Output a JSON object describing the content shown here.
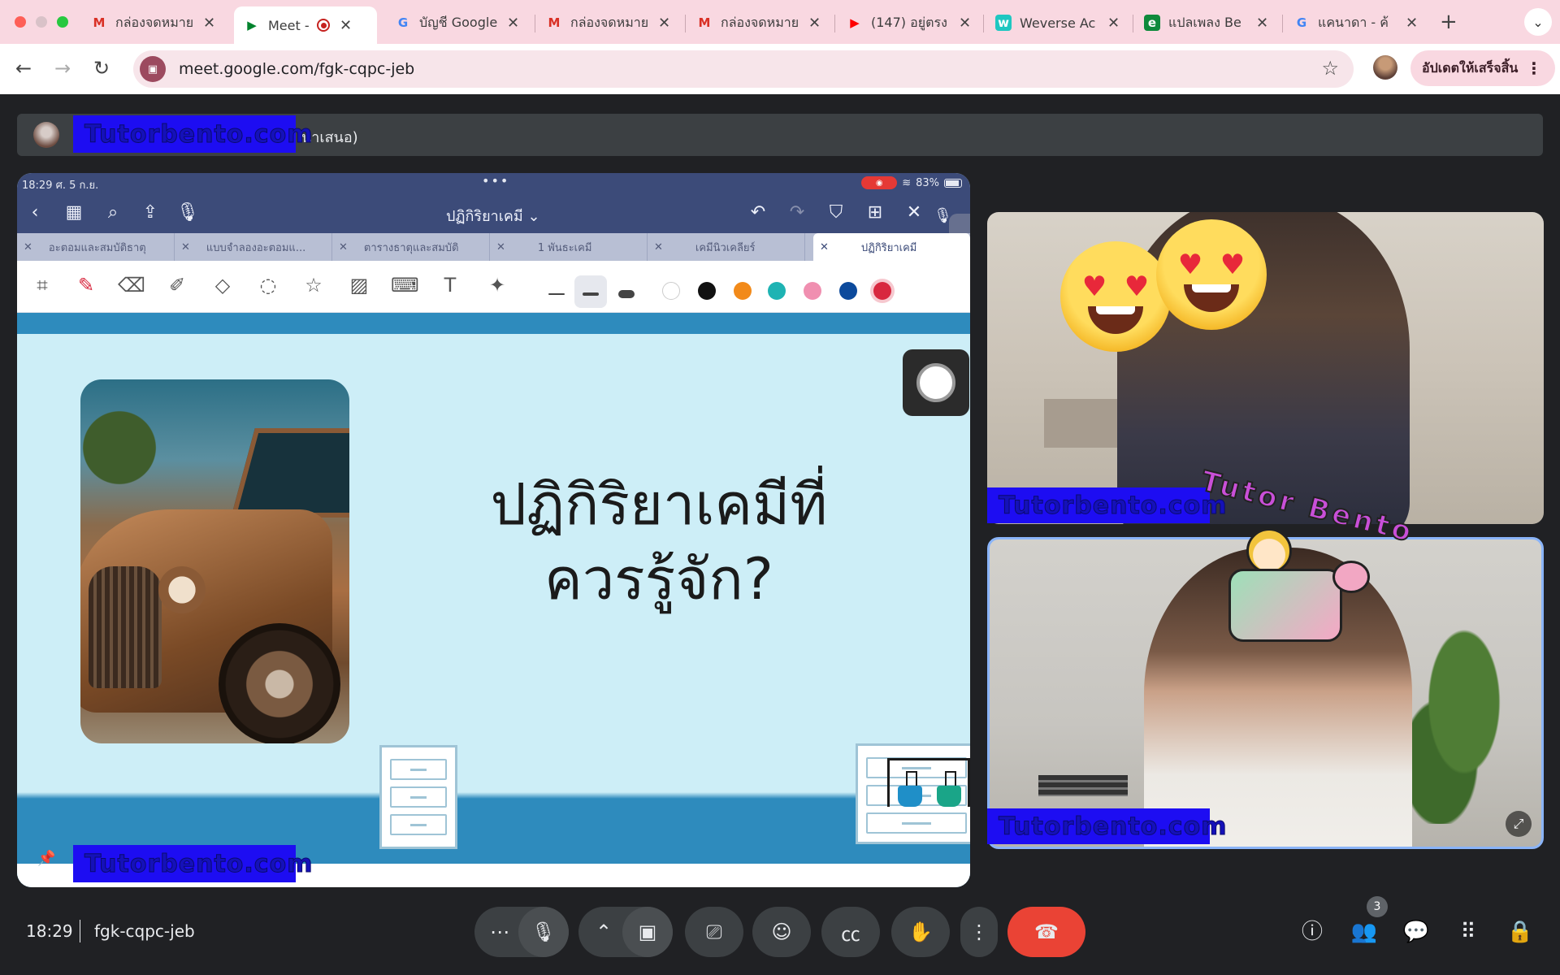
{
  "browser": {
    "tabs": [
      {
        "title": "กล่องจดหมาย",
        "icon": "gmail-icon"
      },
      {
        "title": "Meet - fgk-cqpc-jeb",
        "icon": "meet-icon",
        "active": true,
        "recording": true
      },
      {
        "title": "บัญชี Google",
        "icon": "google-icon"
      },
      {
        "title": "กล่องจดหมาย",
        "icon": "gmail-icon"
      },
      {
        "title": "กล่องจดหมาย",
        "icon": "gmail-icon"
      },
      {
        "title": "(147) อยู่ตรง",
        "icon": "youtube-icon"
      },
      {
        "title": "Weverse Ac",
        "icon": "weverse-icon"
      },
      {
        "title": "แปลเพลง Be",
        "icon": "e-icon"
      },
      {
        "title": "แคนาดา - ค้",
        "icon": "google-icon"
      }
    ],
    "url": "meet.google.com/fgk-cqpc-jeb",
    "update_label": "อัปเดตให้เสร็จสิ้น",
    "colors": {
      "tabstrip": "#f9d8e1",
      "toolbar": "#ffffff"
    }
  },
  "meet": {
    "presenter_text": "นำเสนอ)",
    "watermark": "Tutorbento.com",
    "meeting_time": "18:29",
    "meeting_code": "fgk-cqpc-jeb",
    "participant_count": "3"
  },
  "ipad": {
    "status_time": "18:29  ศ. 5 ก.ย.",
    "battery": "83%",
    "doc_title": "ปฏิกิริยาเคมี",
    "doc_tabs": [
      "อะตอมและสมบัติธาตุ",
      "แบบจำลองอะตอมแ...",
      "ตารางธาตุและสมบัติ",
      "1 พันธะเคมี",
      "เคมีนิวเคลียร์",
      "ปฏิกิริยาเคมี"
    ],
    "palette": [
      "#ffffff",
      "#111111",
      "#f28a1a",
      "#1eb3b3",
      "#f08fb0",
      "#0c4a9c",
      "#d8283f"
    ]
  },
  "slide": {
    "title_line1": "ปฏิกิริยาเคมีที่",
    "title_line2": "ควรรู้จัก?"
  },
  "sticker": {
    "text": "Tutor Bento"
  }
}
